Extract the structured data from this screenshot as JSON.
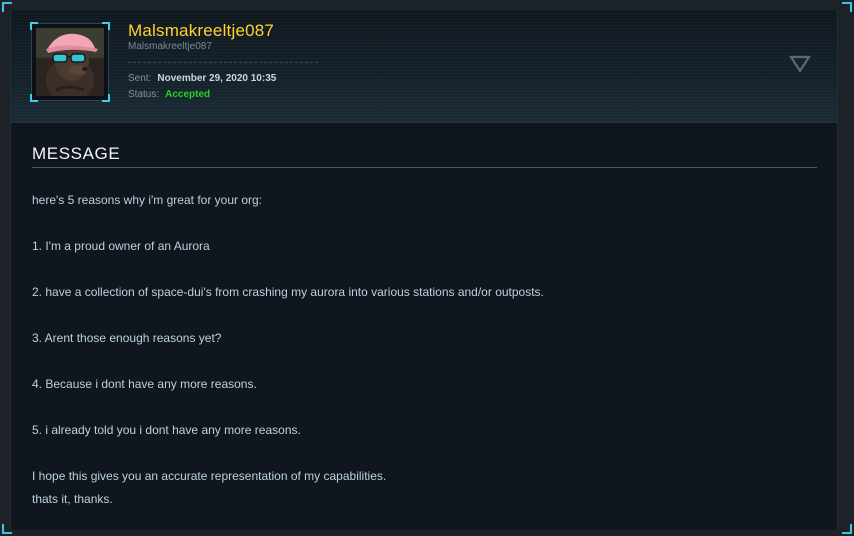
{
  "profile": {
    "username": "Malsmakreeltje087",
    "handle": "Malsmakreeltje087",
    "sent_label": "Sent:",
    "sent_value": "November 29, 2020 10:35",
    "status_label": "Status:",
    "status_value": "Accepted",
    "avatar_icon": "avatar-pink-cap-sunglasses"
  },
  "section": {
    "title": "MESSAGE"
  },
  "message": {
    "lines": [
      "here's 5 reasons why i'm great for your org:",
      "",
      "1. I'm a proud owner of an Aurora",
      "",
      "2. have a collection of space-dui's from crashing my aurora into various stations and/or outposts.",
      "",
      "3. Arent those enough reasons yet?",
      "",
      "4. Because i dont have any more reasons.",
      "",
      "5. i already told you i dont have any more reasons.",
      "",
      "I hope this gives you an accurate representation of my capabilities.",
      "thats it, thanks."
    ]
  },
  "colors": {
    "username": "#ffd22e",
    "status_accepted": "#22d41f",
    "accent_cyan": "#3ed0e6",
    "body_text": "#bcd1e0"
  },
  "icons": {
    "collapse": "chevron-down-triangle-icon"
  }
}
